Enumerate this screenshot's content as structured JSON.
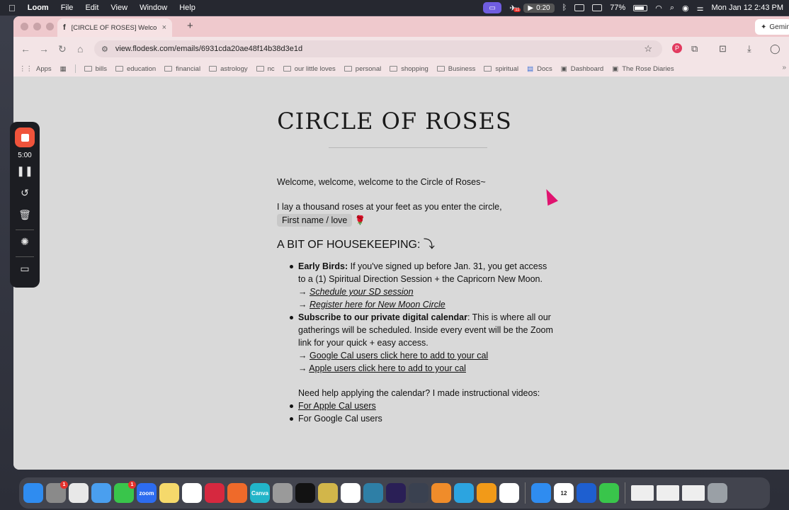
{
  "menubar": {
    "apple": "",
    "app_name": "Loom",
    "menus": [
      "File",
      "Edit",
      "View",
      "Window",
      "Help"
    ],
    "recording_time": "0:20",
    "notification_count": "11",
    "battery": "77%",
    "datetime": "Mon Jan 12  2:43 PM"
  },
  "browser": {
    "tab_favicon": "f",
    "tab_title": "[CIRCLE OF ROSES] Welcome",
    "new_tab": "+",
    "gemini_label": "Gemini",
    "url": "view.flodesk.com/emails/6931cda20ae48f14b38d3e1d",
    "bookmarks": [
      "Apps",
      "bills",
      "education",
      "financial",
      "astrology",
      "nc",
      "our little loves",
      "personal",
      "shopping",
      "Business",
      "spiritual",
      "Docs",
      "Dashboard",
      "The Rose Diaries"
    ]
  },
  "email": {
    "brand": "CIRCLE OF ROSES",
    "welcome": "Welcome, welcome, welcome to the Circle of Roses~",
    "intro": "I lay a thousand roses at your feet as you enter the circle,",
    "merge_tag": "First name / love",
    "rose": "🌹",
    "heading": "A BIT OF HOUSEKEEPING: ⤵",
    "early_birds_label": "Early Birds:",
    "early_birds_text": " If you've signed up before Jan. 31, you get access to a (1) Spiritual Direction Session + the Capricorn New Moon.",
    "arrow": "→ ",
    "schedule_link": "Schedule your SD session",
    "register_link": "Register here for New Moon Circle",
    "subscribe_label": "Subscribe to our private digital calendar",
    "subscribe_text": ": This is where all our gatherings will be scheduled. Inside every event will be the Zoom link for your quick + easy access.",
    "google_link": "Google Cal users click here to add to your cal",
    "apple_link": "Apple users click here to add to your cal",
    "help_text": "Need help applying the calendar? I made instructional videos:",
    "apple_videos": "For Apple Cal users",
    "google_videos": "For Google Cal users"
  },
  "loom": {
    "timer": "5:00"
  },
  "dock": {
    "apps": [
      {
        "name": "finder",
        "color": "#2f8cf0",
        "label": ""
      },
      {
        "name": "system-settings",
        "color": "#8a8a8a",
        "label": "",
        "badge": "1"
      },
      {
        "name": "calendar-app",
        "color": "#e8e8e8",
        "label": ""
      },
      {
        "name": "mail",
        "color": "#4a9fef",
        "label": ""
      },
      {
        "name": "messages",
        "color": "#39c54b",
        "label": "",
        "badge": "1"
      },
      {
        "name": "zoom",
        "color": "#2d6cf0",
        "label": "zoom"
      },
      {
        "name": "notes",
        "color": "#f5d96b",
        "label": ""
      },
      {
        "name": "chrome",
        "color": "#ffffff",
        "label": ""
      },
      {
        "name": "app-red",
        "color": "#d6283f",
        "label": ""
      },
      {
        "name": "app-orange",
        "color": "#ef6a2a",
        "label": ""
      },
      {
        "name": "canva",
        "color": "#22b5c9",
        "label": "Canva"
      },
      {
        "name": "calculator",
        "color": "#9a9a9a",
        "label": ""
      },
      {
        "name": "spotify",
        "color": "#121212",
        "label": ""
      },
      {
        "name": "app-yellow",
        "color": "#d2b64a",
        "label": ""
      },
      {
        "name": "photos",
        "color": "#ffffff",
        "label": ""
      },
      {
        "name": "app-blue-ring",
        "color": "#2e7fa6",
        "label": ""
      },
      {
        "name": "app-night",
        "color": "#2a1f56",
        "label": ""
      },
      {
        "name": "app-dark",
        "color": "#3a4150",
        "label": ""
      },
      {
        "name": "books",
        "color": "#f08c2a",
        "label": ""
      },
      {
        "name": "telegram",
        "color": "#2ca4e0",
        "label": ""
      },
      {
        "name": "audible",
        "color": "#f29a18",
        "label": ""
      },
      {
        "name": "clickup",
        "color": "#ffffff",
        "label": ""
      },
      {
        "name": "safari",
        "color": "#2f8cf0",
        "label": ""
      },
      {
        "name": "calendar-date",
        "color": "#ffffff",
        "label": "12"
      },
      {
        "name": "app-star",
        "color": "#1e5fd0",
        "label": ""
      },
      {
        "name": "phone",
        "color": "#39c54b",
        "label": ""
      }
    ]
  }
}
